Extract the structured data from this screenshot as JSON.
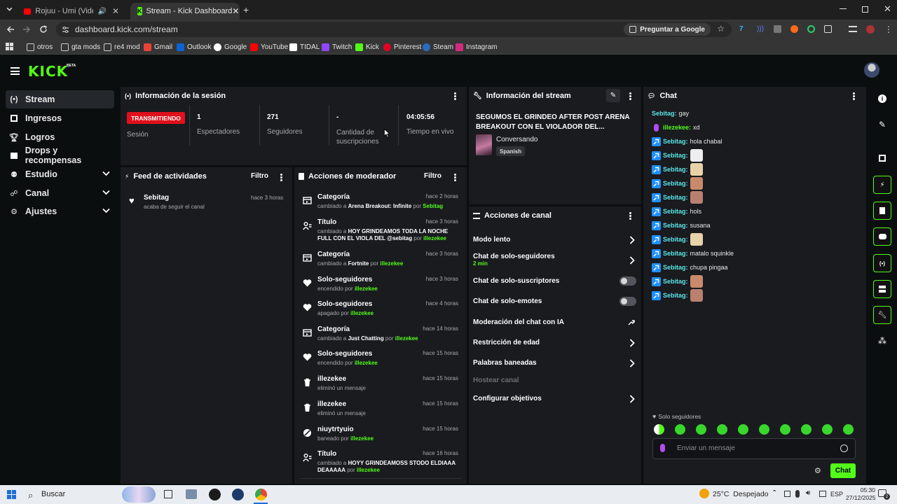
{
  "browser": {
    "tabs": [
      {
        "label": "Rojuu - Umi (Videoclip) - Yo"
      },
      {
        "label": "Stream - Kick Dashboard"
      }
    ],
    "url": "dashboard.kick.com/stream",
    "ask_google": "Preguntar a Google",
    "bookmarks": [
      "otros",
      "gta mods",
      "re4 mod",
      "Gmail",
      "Outlook",
      "Google",
      "YouTube",
      "TIDAL",
      "Twitch",
      "Kick",
      "Pinterest",
      "Steam",
      "Instagram"
    ]
  },
  "header": {
    "logo": "KICK",
    "beta": "BETA"
  },
  "sidebar": {
    "items": [
      {
        "label": "Stream",
        "icon": "broadcast-icon"
      },
      {
        "label": "Ingresos",
        "icon": "revenue-icon"
      },
      {
        "label": "Logros",
        "icon": "trophy-icon"
      },
      {
        "label": "Drops y recompensas",
        "icon": "gift-icon"
      },
      {
        "label": "Estudio",
        "icon": "studio-icon"
      },
      {
        "label": "Canal",
        "icon": "channel-icon"
      },
      {
        "label": "Ajustes",
        "icon": "gear-icon"
      }
    ]
  },
  "session": {
    "title": "Información de la sesión",
    "live_badge": "TRANSMITIENDO",
    "session_label": "Sesión",
    "stats": [
      {
        "value": "1",
        "label": "Espectadores"
      },
      {
        "value": "271",
        "label": "Seguidores"
      },
      {
        "value": "-",
        "label": "Cantidad de suscripciones"
      },
      {
        "value": "04:05:56",
        "label": "Tiempo en vivo"
      }
    ]
  },
  "stream_info": {
    "title": "Información del stream",
    "stream_title": "SEGUMOS EL GRINDEO AFTER POST ARENA BREAKOUT CON EL VIOLADOR DEL...",
    "category": "Conversando",
    "language": "Spanish"
  },
  "activity": {
    "title": "Feed de actividades",
    "filter": "Filtro",
    "items": [
      {
        "user": "Sebitag",
        "text": "acaba de seguir el canal",
        "time": "hace 3 horas"
      }
    ]
  },
  "moderator": {
    "title": "Acciones de moderador",
    "filter": "Filtro",
    "items": [
      {
        "title": "Categoría",
        "pre": "cambiado a ",
        "value": "Arena Breakout: Infinite",
        "mid": " por ",
        "by": "Sebitag",
        "time": "hace 2 horas",
        "icon": "category-icon"
      },
      {
        "title": "Título",
        "pre": "cambiado a ",
        "value": "HOY GRINDEAMOS TODA LA NOCHE FULL CON EL VIOLA DEL @sebitag",
        "mid": " por ",
        "by": "illezekee",
        "time": "hace 3 horas",
        "icon": "title-icon"
      },
      {
        "title": "Categoría",
        "pre": "cambiado a ",
        "value": "Fortnite",
        "mid": " por ",
        "by": "illezekee",
        "time": "hace 3 horas",
        "icon": "category-icon"
      },
      {
        "title": "Solo-seguidores",
        "pre": "encendido",
        "value": "",
        "mid": " por ",
        "by": "illezekee",
        "time": "hace 3 horas",
        "icon": "heart-icon"
      },
      {
        "title": "Solo-seguidores",
        "pre": "apagado",
        "value": "",
        "mid": " por ",
        "by": "illezekee",
        "time": "hace 4 horas",
        "icon": "heart-icon"
      },
      {
        "title": "Categoría",
        "pre": "cambiado a ",
        "value": "Just Chatting",
        "mid": " por ",
        "by": "illezekee",
        "time": "hace 14 horas",
        "icon": "category-icon"
      },
      {
        "title": "Solo-seguidores",
        "pre": "encendido",
        "value": "",
        "mid": " por ",
        "by": "illezekee",
        "time": "hace 15 horas",
        "icon": "heart-icon"
      },
      {
        "title": "illezekee",
        "pre": "eliminó un mensaje",
        "value": "",
        "mid": "",
        "by": "",
        "time": "hace 15 horas",
        "icon": "trash-icon"
      },
      {
        "title": "illezekee",
        "pre": "eliminó un mensaje",
        "value": "",
        "mid": "",
        "by": "",
        "time": "hace 15 horas",
        "icon": "trash-icon"
      },
      {
        "title": "niuytrtyuio",
        "pre": "baneado",
        "value": "",
        "mid": " por ",
        "by": "illezekee",
        "time": "hace 15 horas",
        "icon": "ban-icon"
      },
      {
        "title": "Título",
        "pre": "cambiado a ",
        "value": "HOYY GRINDEAMOSS STODO ELDIAAA DEAAAAA",
        "mid": " por ",
        "by": "illezekee",
        "time": "hace 16 horas",
        "icon": "title-icon"
      }
    ]
  },
  "channel_actions": {
    "title": "Acciones de canal",
    "items": [
      {
        "label": "Modo lento",
        "control": "arrow",
        "sub": ""
      },
      {
        "label": "Chat de solo-seguidores",
        "control": "arrow",
        "sub": "2 min"
      },
      {
        "label": "Chat de solo-suscriptores",
        "control": "toggle",
        "sub": ""
      },
      {
        "label": "Chat de solo-emotes",
        "control": "toggle",
        "sub": ""
      },
      {
        "label": "Moderación del chat con IA",
        "control": "external",
        "sub": ""
      },
      {
        "label": "Restricción de edad",
        "control": "arrow",
        "sub": ""
      },
      {
        "label": "Palabras baneadas",
        "control": "arrow",
        "sub": ""
      },
      {
        "label": "Hostear canal",
        "control": "none",
        "sub": ""
      },
      {
        "label": "Configurar objetivos",
        "control": "arrow",
        "sub": ""
      }
    ]
  },
  "chat": {
    "title": "Chat",
    "messages": [
      {
        "user": "Sebitag",
        "text": "gay",
        "badge": "none",
        "emote": ""
      },
      {
        "user": "illezekee",
        "text": "xd",
        "badge": "mic",
        "emote": ""
      },
      {
        "user": "Sebitag",
        "text": "hola chabal",
        "badge": "bolt",
        "emote": ""
      },
      {
        "user": "Sebitag",
        "text": "",
        "badge": "bolt",
        "emote": "#eeeeee"
      },
      {
        "user": "Sebitag",
        "text": "",
        "badge": "bolt",
        "emote": "#e8d2a8"
      },
      {
        "user": "Sebitag",
        "text": "",
        "badge": "bolt",
        "emote": "#c98a6c"
      },
      {
        "user": "Sebitag",
        "text": "",
        "badge": "bolt",
        "emote": "#b98070"
      },
      {
        "user": "Sebitag",
        "text": "hols",
        "badge": "bolt",
        "emote": ""
      },
      {
        "user": "Sebitag",
        "text": "susana",
        "badge": "bolt",
        "emote": ""
      },
      {
        "user": "Sebitag",
        "text": "",
        "badge": "bolt",
        "emote": "#e8d2a8"
      },
      {
        "user": "Sebitag",
        "text": "matalo squinkle",
        "badge": "bolt",
        "emote": ""
      },
      {
        "user": "Sebitag",
        "text": "chupa pingaa",
        "badge": "bolt",
        "emote": ""
      },
      {
        "user": "Sebitag",
        "text": "",
        "badge": "bolt",
        "emote": "#c98a6c"
      },
      {
        "user": "Sebitag",
        "text": "",
        "badge": "bolt",
        "emote": "#b98070"
      }
    ],
    "followers_only": "Solo seguidores",
    "placeholder": "Enviar un mensaje",
    "send": "Chat"
  },
  "taskbar": {
    "search": "Buscar",
    "weather": "25°C  Despejado",
    "lang": "ESP",
    "time": "05:30",
    "date": "27/12/2025",
    "notif": "2"
  },
  "colors": {
    "accent": "#53fc18",
    "live": "#e0101c",
    "username": "#5de6e9",
    "badge": "#1e90ff"
  }
}
